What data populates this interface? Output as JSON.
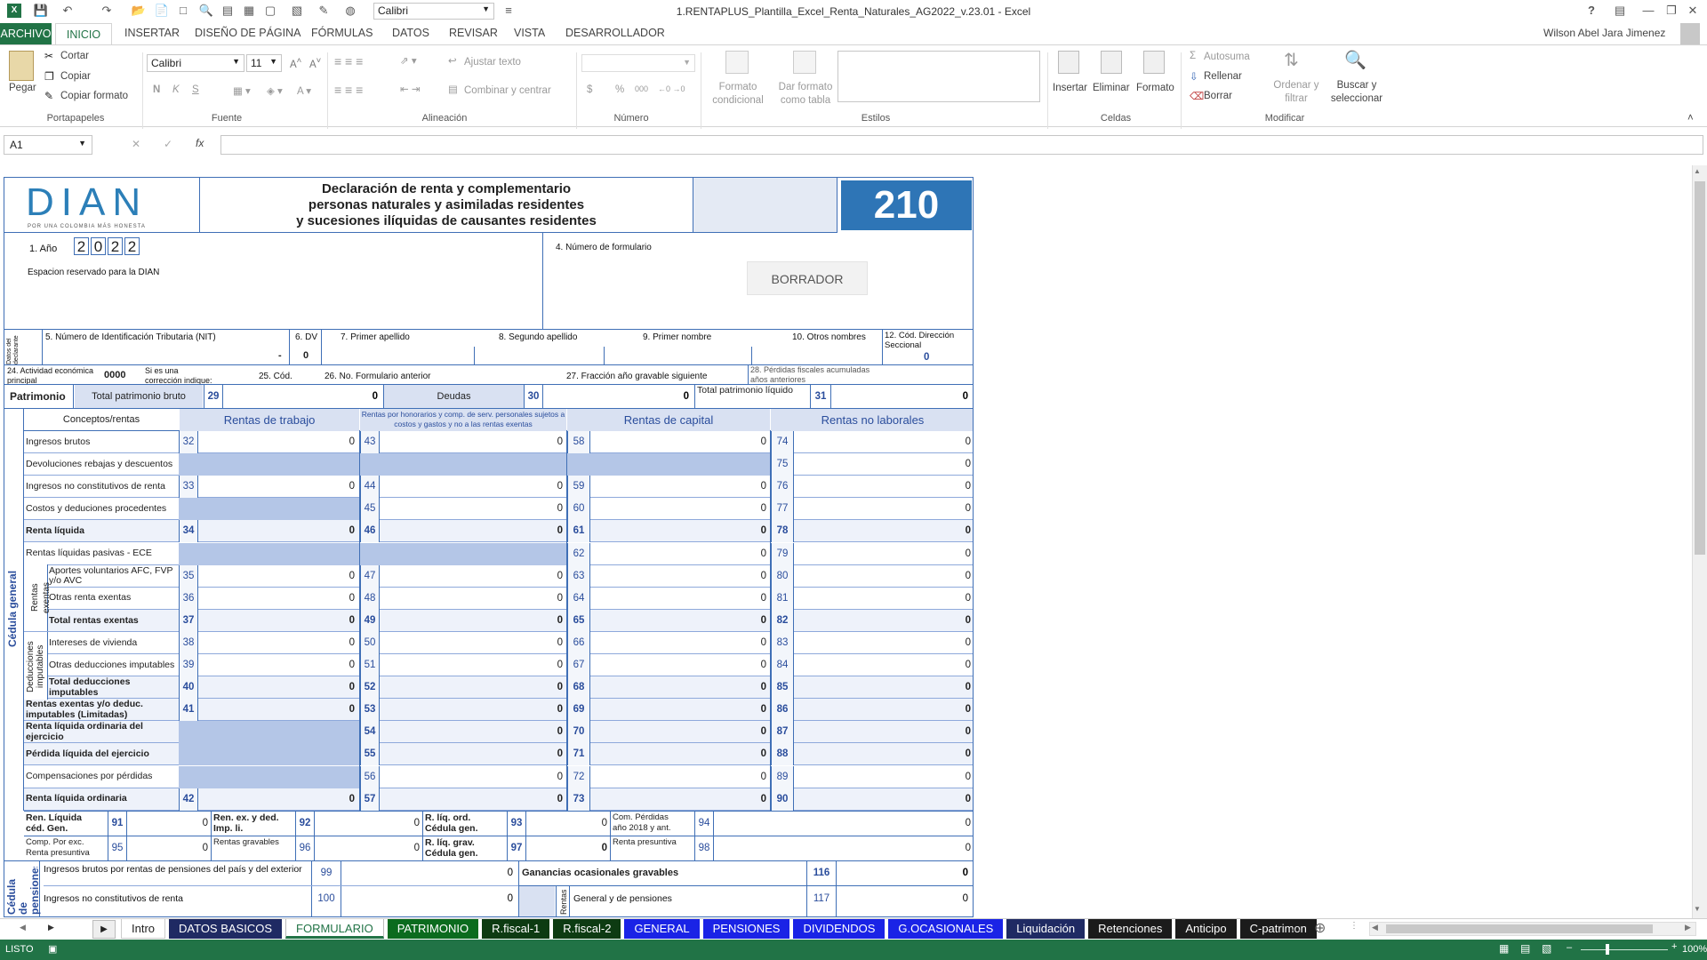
{
  "window": {
    "title": "1.RENTAPLUS_Plantilla_Excel_Renta_Naturales_AG2022_v.23.01 - Excel",
    "user": "Wilson Abel Jara Jimenez",
    "font_box": "Calibri"
  },
  "tabs": [
    "ARCHIVO",
    "INICIO",
    "INSERTAR",
    "DISEÑO DE PÁGINA",
    "FÓRMULAS",
    "DATOS",
    "REVISAR",
    "VISTA",
    "DESARROLLADOR"
  ],
  "ribbon": {
    "clipboard": {
      "paste": "Pegar",
      "cut": "Cortar",
      "copy": "Copiar",
      "format_copy": "Copiar formato",
      "group": "Portapapeles"
    },
    "font": {
      "name": "Calibri",
      "size": "11",
      "group": "Fuente",
      "bold": "N",
      "italic": "K",
      "underline": "S"
    },
    "alignment": {
      "wrap": "Ajustar texto",
      "merge": "Combinar y centrar",
      "group": "Alineación"
    },
    "number": {
      "group": "Número",
      "currency": "$",
      "percent": "%",
      "thousands": "000"
    },
    "styles": {
      "conditional": "Formato condicional",
      "table": "Dar formato como tabla",
      "group": "Estilos"
    },
    "cells": {
      "insert": "Insertar",
      "delete": "Eliminar",
      "format": "Formato",
      "group": "Celdas"
    },
    "modify": {
      "autosum": "Autosuma",
      "fill": "Rellenar",
      "clear": "Borrar",
      "sort": "Ordenar y filtrar",
      "find": "Buscar y seleccionar",
      "group": "Modificar"
    }
  },
  "formula_bar": {
    "name_box": "A1",
    "fx": "fx",
    "value": ""
  },
  "form": {
    "logo": "DIAN",
    "logo_tag": "POR UNA COLOMBIA MÁS HONESTA",
    "title1": "Declaración de renta y complementario",
    "title2": "personas naturales y asimiladas residentes",
    "title3": "y sucesiones ilíquidas de causantes residentes",
    "code": "210",
    "year_label": "1. Año",
    "year_digits": [
      "2",
      "0",
      "2",
      "2"
    ],
    "reserved": "Espacion reservado para la DIAN",
    "form_number_label": "4. Número de formulario",
    "draft": "BORRADOR",
    "declarant_side": "Datos del declarante",
    "nit_label": "5. Número de Identificación Tributaria (NIT)",
    "dv_label": "6. DV",
    "dash": "-",
    "dv_value": "0",
    "ap1": "7. Primer apellido",
    "ap2": "8. Segundo apellido",
    "nom1": "9. Primer nombre",
    "nom_others": "10. Otros nombres",
    "dir_label": "12. Cód. Dirección Seccional",
    "dir_value": "0",
    "act_label": "24. Actividad económica principal",
    "act_value": "0000",
    "corr_label": "Si es una corrección indique:",
    "cod_label": "25. Cód.",
    "prev_label": "26. No. Formulario anterior",
    "frac_label": "27. Fracción año gravable siguiente",
    "loss_label": "28. Pérdidas fiscales acumuladas años anteriores",
    "patrimonio": {
      "label": "Patrimonio",
      "bruto": "Total patrimonio bruto",
      "n29": "29",
      "v29": "0",
      "deudas": "Deudas",
      "n30": "30",
      "v30": "0",
      "liquido": "Total patrimonio líquido",
      "n31": "31",
      "v31": "0"
    },
    "cedula_general": "Cédula general",
    "headers": {
      "concepts": "Conceptos/rentas",
      "trabajo": "Rentas de trabajo",
      "honorarios": "Rentas por honorarios y comp. de serv. personales sujetos a costos y gastos y no a las rentas exentas",
      "capital": "Rentas de capital",
      "no_laborales": "Rentas no laborales"
    },
    "side_exentas": "Rentas exentas",
    "side_deducciones": "Deducciones imputables",
    "rows": [
      {
        "label": "Ingresos brutos",
        "bold": false,
        "c": [
          [
            "32",
            "0"
          ],
          [
            "43",
            "0"
          ],
          [
            "58",
            "0"
          ],
          [
            "74",
            "0"
          ]
        ]
      },
      {
        "label": "Devoluciones rebajas y descuentos",
        "bold": false,
        "c": [
          null,
          null,
          null,
          [
            "75",
            "0"
          ]
        ]
      },
      {
        "label": "Ingresos no constitutivos de renta",
        "bold": false,
        "c": [
          [
            "33",
            "0"
          ],
          [
            "44",
            "0"
          ],
          [
            "59",
            "0"
          ],
          [
            "76",
            "0"
          ]
        ]
      },
      {
        "label": "Costos y deduciones procedentes",
        "bold": false,
        "c": [
          null,
          [
            "45",
            "0"
          ],
          [
            "60",
            "0"
          ],
          [
            "77",
            "0"
          ]
        ]
      },
      {
        "label": "Renta líquida",
        "bold": true,
        "c": [
          [
            "34",
            "0"
          ],
          [
            "46",
            "0"
          ],
          [
            "61",
            "0"
          ],
          [
            "78",
            "0"
          ]
        ]
      },
      {
        "label": "Rentas líquidas pasivas - ECE",
        "bold": false,
        "c": [
          null,
          null,
          [
            "62",
            "0"
          ],
          [
            "79",
            "0"
          ]
        ]
      },
      {
        "label": "Aportes voluntarios AFC, FVP y/o AVC",
        "bold": false,
        "c": [
          [
            "35",
            "0"
          ],
          [
            "47",
            "0"
          ],
          [
            "63",
            "0"
          ],
          [
            "80",
            "0"
          ]
        ]
      },
      {
        "label": "Otras renta exentas",
        "bold": false,
        "c": [
          [
            "36",
            "0"
          ],
          [
            "48",
            "0"
          ],
          [
            "64",
            "0"
          ],
          [
            "81",
            "0"
          ]
        ]
      },
      {
        "label": "Total rentas exentas",
        "bold": true,
        "c": [
          [
            "37",
            "0"
          ],
          [
            "49",
            "0"
          ],
          [
            "65",
            "0"
          ],
          [
            "82",
            "0"
          ]
        ]
      },
      {
        "label": "Intereses de vivienda",
        "bold": false,
        "c": [
          [
            "38",
            "0"
          ],
          [
            "50",
            "0"
          ],
          [
            "66",
            "0"
          ],
          [
            "83",
            "0"
          ]
        ]
      },
      {
        "label": "Otras deducciones imputables",
        "bold": false,
        "c": [
          [
            "39",
            "0"
          ],
          [
            "51",
            "0"
          ],
          [
            "67",
            "0"
          ],
          [
            "84",
            "0"
          ]
        ]
      },
      {
        "label": "Total deducciones imputables",
        "bold": true,
        "c": [
          [
            "40",
            "0"
          ],
          [
            "52",
            "0"
          ],
          [
            "68",
            "0"
          ],
          [
            "85",
            "0"
          ]
        ]
      },
      {
        "label": "Rentas exentas y/o deduc. imputables (Limitadas)",
        "bold": true,
        "c": [
          [
            "41",
            "0"
          ],
          [
            "53",
            "0"
          ],
          [
            "69",
            "0"
          ],
          [
            "86",
            "0"
          ]
        ]
      },
      {
        "label": "Renta líquida ordinaria del ejercicio",
        "bold": true,
        "c": [
          null,
          [
            "54",
            "0"
          ],
          [
            "70",
            "0"
          ],
          [
            "87",
            "0"
          ]
        ]
      },
      {
        "label": "Pérdida líquida del ejercicio",
        "bold": true,
        "c": [
          null,
          [
            "55",
            "0"
          ],
          [
            "71",
            "0"
          ],
          [
            "88",
            "0"
          ]
        ]
      },
      {
        "label": "Compensaciones por pérdidas",
        "bold": false,
        "c": [
          null,
          [
            "56",
            "0"
          ],
          [
            "72",
            "0"
          ],
          [
            "89",
            "0"
          ]
        ]
      },
      {
        "label": "Renta líquida ordinaria",
        "bold": true,
        "c": [
          [
            "42",
            "0"
          ],
          [
            "57",
            "0"
          ],
          [
            "73",
            "0"
          ],
          [
            "90",
            "0"
          ]
        ]
      }
    ],
    "summary": [
      [
        {
          "l": "Ren. Líquida céd. Gen.",
          "n": "91",
          "v": "0"
        },
        {
          "l": "Ren. ex. y ded. Imp. li.",
          "n": "92",
          "v": "0"
        },
        {
          "l": "R. líq. ord. Cédula gen.",
          "n": "93",
          "v": "0"
        },
        {
          "l": "Com. Pérdidas año 2018 y ant.",
          "n": "94",
          "v": "0"
        }
      ],
      [
        {
          "l": "Comp. Por exc. Renta presuntiva",
          "n": "95",
          "v": "0"
        },
        {
          "l": "Rentas gravables",
          "n": "96",
          "v": "0"
        },
        {
          "l": "R. líq. grav. Cédula gen.",
          "n": "97",
          "v": "0"
        },
        {
          "l": "Renta presuntiva",
          "n": "98",
          "v": "0"
        }
      ]
    ],
    "pensiones_side": "Cédula de pensiones",
    "pens_rows": [
      {
        "l": "Ingresos brutos por rentas de pensiones del país y del exterior",
        "n": "99",
        "v": "0"
      },
      {
        "l": "Ingresos no constitutivos de renta",
        "n": "100",
        "v": "0"
      }
    ],
    "ganancias": {
      "l": "Ganancias ocasionales gravables",
      "n": "116",
      "v": "0"
    },
    "ganancias_side": "Rentas",
    "general_pens": {
      "l": "General y de pensiones",
      "n": "117",
      "v": "0"
    }
  },
  "sheet_tabs": [
    {
      "name": "Intro",
      "bg": "#ffffff",
      "fg": "#222222"
    },
    {
      "name": "DATOS BASICOS",
      "bg": "#1f2a63",
      "fg": "#ffffff"
    },
    {
      "name": "FORMULARIO",
      "bg": "#ffffff",
      "fg": "#217346",
      "active": true
    },
    {
      "name": "PATRIMONIO",
      "bg": "#0b6b1e",
      "fg": "#ffffff"
    },
    {
      "name": "R.fiscal-1",
      "bg": "#0d3b12",
      "fg": "#ffffff"
    },
    {
      "name": "R.fiscal-2",
      "bg": "#0d3b12",
      "fg": "#ffffff"
    },
    {
      "name": "GENERAL",
      "bg": "#1a23e6",
      "fg": "#ffffff"
    },
    {
      "name": "PENSIONES",
      "bg": "#1a23e6",
      "fg": "#ffffff"
    },
    {
      "name": "DIVIDENDOS",
      "bg": "#1a23e6",
      "fg": "#ffffff"
    },
    {
      "name": "G.OCASIONALES",
      "bg": "#1a23e6",
      "fg": "#ffffff"
    },
    {
      "name": "Liquidación",
      "bg": "#1f2a63",
      "fg": "#ffffff"
    },
    {
      "name": "Retenciones",
      "bg": "#1b1b1b",
      "fg": "#ffffff"
    },
    {
      "name": "Anticipo",
      "bg": "#1b1b1b",
      "fg": "#ffffff"
    },
    {
      "name": "C-patrimon",
      "bg": "#1b1b1b",
      "fg": "#ffffff"
    }
  ],
  "tabs_more": "...",
  "status": {
    "ready": "LISTO",
    "zoom": "100%"
  }
}
